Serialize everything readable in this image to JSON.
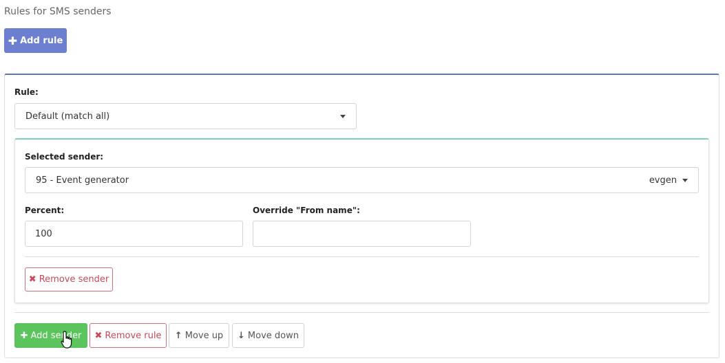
{
  "page": {
    "title": "Rules for SMS senders",
    "add_rule_label": "Add rule"
  },
  "rule": {
    "label": "Rule:",
    "selected": "Default (match all)",
    "sender": {
      "label": "Selected sender:",
      "value": "95 - Event generator",
      "tag": "evgen",
      "percent_label": "Percent:",
      "percent_value": "100",
      "from_name_label": "Override \"From name\":",
      "from_name_value": "",
      "remove_label": "Remove sender"
    },
    "actions": {
      "add_sender": "Add sender",
      "remove_rule": "Remove rule",
      "move_up": "Move up",
      "move_down": "Move down"
    }
  },
  "colors": {
    "primary": "#6d7fd1",
    "success": "#5cc45c",
    "danger": "#c9485a",
    "rule_border": "#5b74c6",
    "sender_border": "#7ecfc0"
  }
}
